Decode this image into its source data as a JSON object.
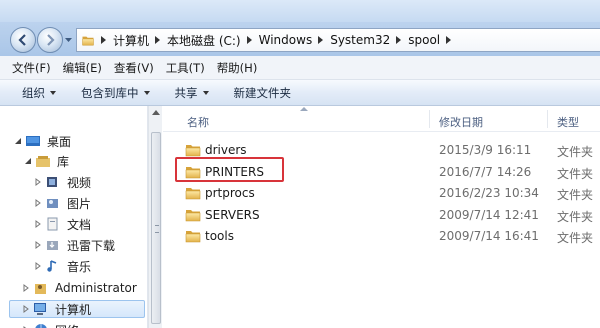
{
  "address": {
    "crumbs": [
      "计算机",
      "本地磁盘 (C:)",
      "Windows",
      "System32",
      "spool"
    ]
  },
  "menu": [
    "文件(F)",
    "编辑(E)",
    "查看(V)",
    "工具(T)",
    "帮助(H)"
  ],
  "toolbar": [
    {
      "label": "组织",
      "dropdown": true
    },
    {
      "label": "包含到库中",
      "dropdown": true
    },
    {
      "label": "共享",
      "dropdown": true
    },
    {
      "label": "新建文件夹",
      "dropdown": false
    }
  ],
  "nav": {
    "desktop": "桌面",
    "libraries": "库",
    "videos": "视频",
    "pictures": "图片",
    "documents": "文档",
    "downloads": "迅雷下载",
    "music": "音乐",
    "admin": "Administrator",
    "computer": "计算机",
    "network": "网络"
  },
  "columns": {
    "name": "名称",
    "date": "修改日期",
    "type": "类型"
  },
  "files": [
    {
      "name": "drivers",
      "date": "2015/3/9 16:11",
      "type": "文件夹"
    },
    {
      "name": "PRINTERS",
      "date": "2016/7/7 14:26",
      "type": "文件夹"
    },
    {
      "name": "prtprocs",
      "date": "2016/2/23 10:34",
      "type": "文件夹"
    },
    {
      "name": "SERVERS",
      "date": "2009/7/14 12:41",
      "type": "文件夹"
    },
    {
      "name": "tools",
      "date": "2009/7/14 16:41",
      "type": "文件夹"
    }
  ],
  "colors": {
    "folder": "#e8b84a",
    "highlight": "#d8343a",
    "selection": "#d5e7fb"
  }
}
